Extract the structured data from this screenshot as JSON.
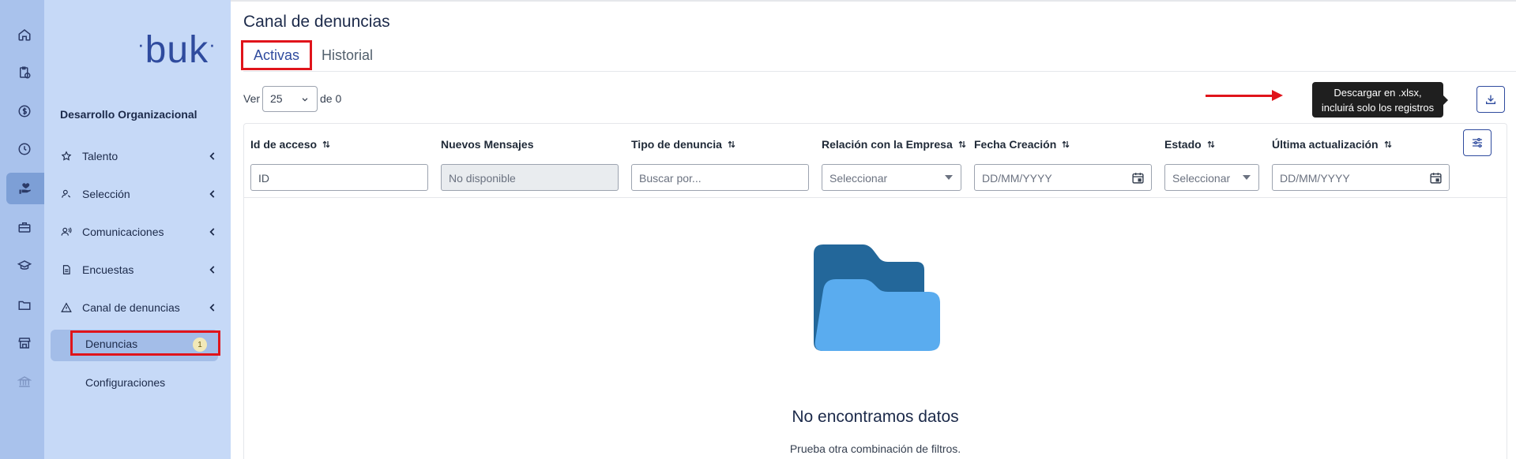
{
  "colors": {
    "accent": "#2f4b9e",
    "highlight": "#e0141b",
    "rail_bg": "#a9c2ec",
    "sidebar_bg": "#c6d9f7",
    "folder_dark": "#23679a",
    "folder_light": "#5aacef"
  },
  "rail": {
    "icons": [
      "home-icon",
      "clipboard-clock-icon",
      "dollar-icon",
      "clock-icon",
      "heart-hand-icon",
      "toolbox-icon",
      "graduation-cap-icon",
      "folder-icon",
      "store-icon",
      "bank-icon"
    ],
    "active_icon": "heart-hand-icon"
  },
  "sidebar": {
    "logo": "buk",
    "section_title": "Desarrollo Organizacional",
    "items": [
      {
        "label": "Talento",
        "icon": "star-icon"
      },
      {
        "label": "Selección",
        "icon": "person-search-icon"
      },
      {
        "label": "Comunicaciones",
        "icon": "megaphone-person-icon"
      },
      {
        "label": "Encuestas",
        "icon": "document-icon"
      },
      {
        "label": "Canal de denuncias",
        "icon": "warning-icon"
      }
    ],
    "sub_items": [
      {
        "label": "Denuncias",
        "badge": "1",
        "active": true
      },
      {
        "label": "Configuraciones",
        "active": false
      }
    ]
  },
  "main": {
    "title": "Canal de denuncias",
    "tabs": [
      {
        "label": "Activas",
        "active": true
      },
      {
        "label": "Historial",
        "active": false
      }
    ],
    "pagination": {
      "ver_label": "Ver",
      "page_size": "25",
      "of_label": "de 0"
    },
    "download_tooltip": "Descargar en .xlsx, incluirá solo los registros filtrados",
    "columns": [
      {
        "label": "Id de acceso",
        "sortable": true,
        "filter_type": "input",
        "placeholder": "ID"
      },
      {
        "label": "Nuevos Mensajes",
        "sortable": false,
        "filter_type": "disabled",
        "placeholder": "No disponible"
      },
      {
        "label": "Tipo de denuncia",
        "sortable": true,
        "filter_type": "input",
        "placeholder": "Buscar por..."
      },
      {
        "label": "Relación con la Empresa",
        "sortable": true,
        "filter_type": "select",
        "placeholder": "Seleccionar"
      },
      {
        "label": "Fecha Creación",
        "sortable": true,
        "filter_type": "date",
        "placeholder": "DD/MM/YYYY"
      },
      {
        "label": "Estado",
        "sortable": true,
        "filter_type": "select",
        "placeholder": "Seleccionar"
      },
      {
        "label": "Última actualización",
        "sortable": true,
        "filter_type": "date",
        "placeholder": "DD/MM/YYYY"
      }
    ],
    "empty_state": {
      "title": "No encontramos datos",
      "subtitle": "Prueba otra combinación de filtros."
    }
  }
}
